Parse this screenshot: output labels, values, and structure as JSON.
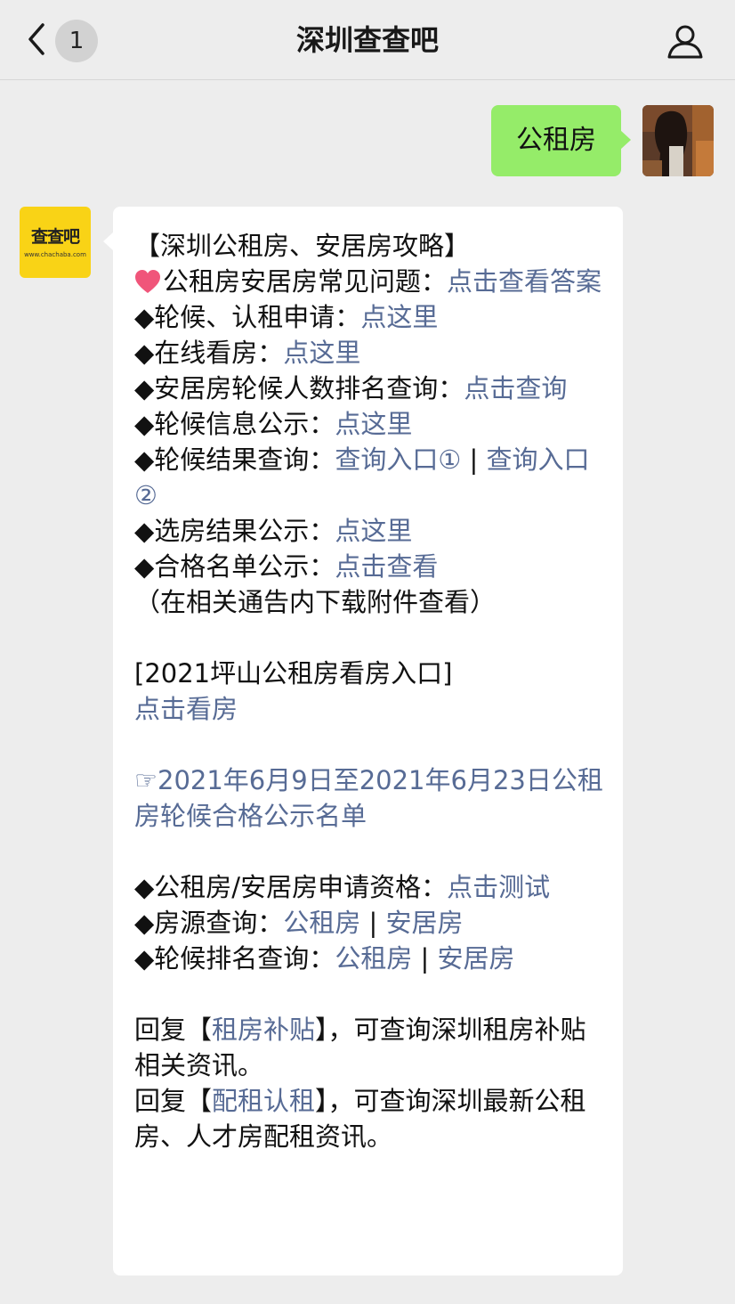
{
  "header": {
    "back_icon": "chevron-left-icon",
    "unread_count": "1",
    "title": "深圳查查吧",
    "profile_icon": "person-icon"
  },
  "outgoing": {
    "text": "公租房"
  },
  "bot_avatar": {
    "logo_text": "查查吧",
    "logo_url": "www.chachaba.com"
  },
  "incoming": {
    "heading": "【深圳公租房、安居房攻略】",
    "faq_label": "公租房安居房常见问题：",
    "faq_link": "点击查看答案",
    "apply_label": "◆轮候、认租申请：",
    "apply_link": "点这里",
    "online_label": "◆在线看房：",
    "online_link": "点这里",
    "rank_label": "◆安居房轮候人数排名查询：",
    "rank_link": "点击查询",
    "info_label": "◆轮候信息公示：",
    "info_link": "点这里",
    "result_label": "◆轮候结果查询：",
    "result_link1": "查询入口①",
    "result_sep": " | ",
    "result_link2": "查询入口②",
    "select_label": "◆选房结果公示：",
    "select_link": "点这里",
    "qualified_label": "◆合格名单公示：",
    "qualified_link": "点击查看",
    "qualified_note": "（在相关通告内下载附件查看）",
    "pingshan_title": "[2021坪山公租房看房入口]",
    "pingshan_link": "点击看房",
    "notice_icon": "☞",
    "notice_link": "2021年6月9日至2021年6月23日公租房轮候合格公示名单",
    "eligibility_label": "◆公租房/安居房申请资格：",
    "eligibility_link": "点击测试",
    "source_label": "◆房源查询：",
    "source_link1": "公租房",
    "source_sep": " | ",
    "source_link2": "安居房",
    "queue_label": "◆轮候排名查询：",
    "queue_link1": "公租房",
    "queue_sep": " | ",
    "queue_link2": "安居房",
    "reply1_prefix": "回复【",
    "reply1_keyword": "租房补贴",
    "reply1_suffix": "】，可查询深圳租房补贴相关资讯。",
    "reply2_prefix": "回复【",
    "reply2_keyword": "配租认租",
    "reply2_suffix": "】，可查询深圳最新公租房、人才房配租资讯。"
  },
  "colors": {
    "background": "#ededed",
    "outgoing_bubble": "#95ec69",
    "link": "#576b95",
    "bot_avatar": "#f9d316",
    "heart": "#f0557a"
  }
}
